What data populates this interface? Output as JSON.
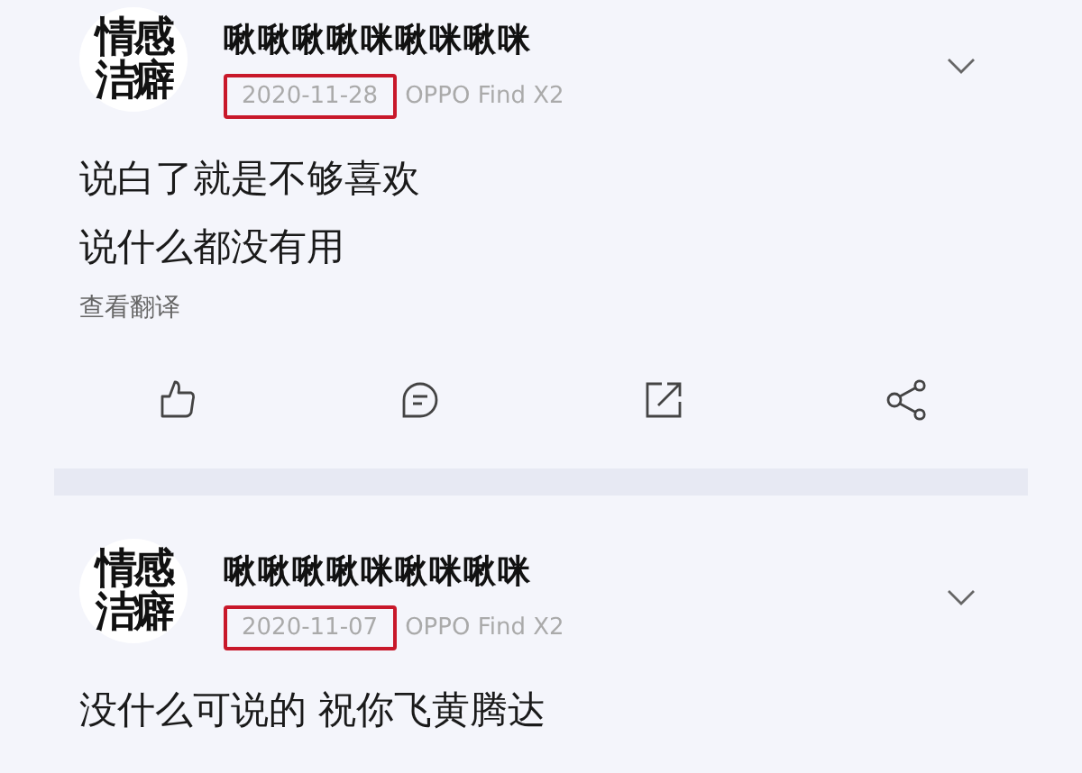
{
  "posts": [
    {
      "avatar_lines": [
        "情感",
        "洁癖"
      ],
      "author": "啾啾啾啾咪啾咪啾咪",
      "date": "2020-11-28",
      "date_highlighted": true,
      "device": "OPPO Find X2",
      "lines": [
        "说白了就是不够喜欢",
        "说什么都没有用"
      ],
      "translate": "查看翻译",
      "actions": [
        {
          "kind": "like"
        },
        {
          "kind": "comment"
        },
        {
          "kind": "repost"
        },
        {
          "kind": "share"
        }
      ]
    },
    {
      "avatar_lines": [
        "情感",
        "洁癖"
      ],
      "author": "啾啾啾啾咪啾咪啾咪",
      "date": "2020-11-07",
      "date_highlighted": true,
      "device": "OPPO Find X2",
      "lines": [
        "没什么可说的 祝你飞黄腾达"
      ]
    }
  ]
}
